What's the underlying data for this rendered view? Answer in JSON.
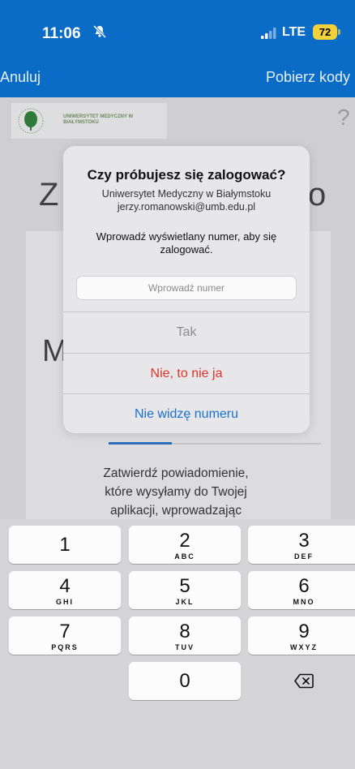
{
  "status_bar": {
    "time": "11:06",
    "network": "LTE",
    "battery": "72",
    "icons": [
      "mute-icon",
      "signal-icon"
    ]
  },
  "nav": {
    "cancel": "Anuluj",
    "get_codes": "Pobierz kody"
  },
  "background": {
    "logo_text": "UNIWERSYTET MEDYCZNY W BIAŁYMSTOKU",
    "help": "?",
    "heading_left": "Z",
    "heading_right": "o",
    "m_letter": "M",
    "instruction": "Zatwierdź powiadomienie, które wysyłamy do Twojej aplikacji, wprowadzając numer pokazany"
  },
  "modal": {
    "title": "Czy próbujesz się zalogować?",
    "organization": "Uniwersytet Medyczny w Białymstoku",
    "email": "jerzy.romanowski@umb.edu.pl",
    "prompt": "Wprowadź wyświetlany numer, aby się zalogować.",
    "input_placeholder": "Wprowadź numer",
    "input_value": "",
    "yes_label": "Tak",
    "no_label": "Nie, to nie ja",
    "no_number_label": "Nie widzę numeru"
  },
  "keypad": {
    "keys": [
      {
        "digit": "1",
        "letters": ""
      },
      {
        "digit": "2",
        "letters": "ABC"
      },
      {
        "digit": "3",
        "letters": "DEF"
      },
      {
        "digit": "4",
        "letters": "GHI"
      },
      {
        "digit": "5",
        "letters": "JKL"
      },
      {
        "digit": "6",
        "letters": "MNO"
      },
      {
        "digit": "7",
        "letters": "PQRS"
      },
      {
        "digit": "8",
        "letters": "TUV"
      },
      {
        "digit": "9",
        "letters": "WXYZ"
      },
      {
        "digit": "0",
        "letters": ""
      }
    ],
    "backspace_icon": "backspace-icon"
  },
  "colors": {
    "header_blue": "#0b6cc7",
    "danger_red": "#e0332b",
    "link_blue": "#1a6fd1",
    "battery_yellow": "#f3d13a"
  }
}
